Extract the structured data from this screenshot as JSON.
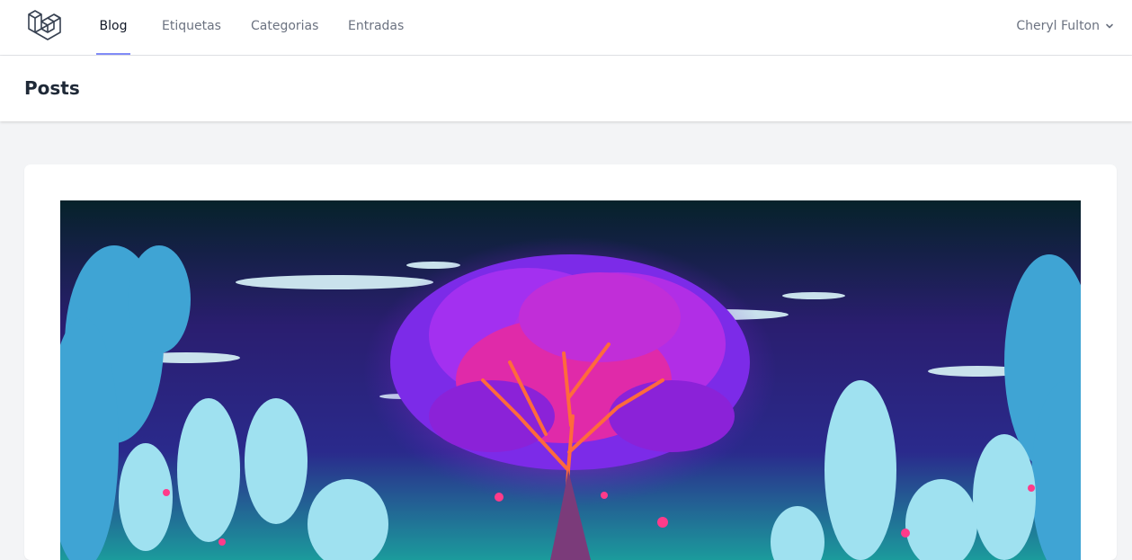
{
  "nav": {
    "links": [
      {
        "label": "Blog",
        "active": true
      },
      {
        "label": "Etiquetas",
        "active": false
      },
      {
        "label": "Categorias",
        "active": false
      },
      {
        "label": "Entradas",
        "active": false
      }
    ],
    "user_name": "Cheryl Fulton",
    "active_underline_color": "#818cf8",
    "logo_icon": "laravel-logo-icon",
    "user_menu_icon": "chevron-down-icon"
  },
  "header": {
    "title": "Posts"
  },
  "post": {
    "image_description_icon": "post-featured-image"
  }
}
